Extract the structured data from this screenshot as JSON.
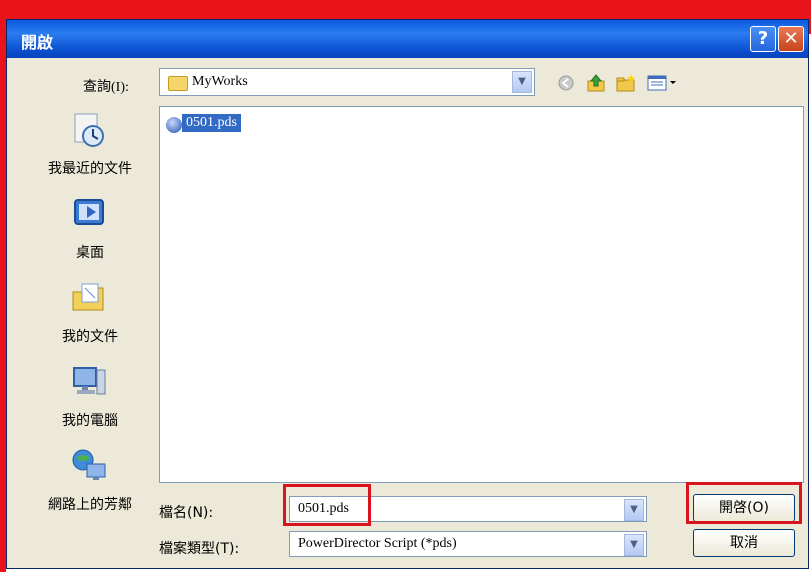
{
  "dialog": {
    "title": "開啟",
    "help_glyph": "?",
    "close_glyph": "✕"
  },
  "lookin": {
    "label": "查詢(I):",
    "value": "MyWorks"
  },
  "toolbar": {
    "icons": [
      "back-icon",
      "up-folder-icon",
      "new-folder-icon",
      "views-menu-icon"
    ]
  },
  "places": [
    {
      "label": "我最近的文件",
      "icon": "recent-documents-icon"
    },
    {
      "label": "桌面",
      "icon": "desktop-icon"
    },
    {
      "label": "我的文件",
      "icon": "my-documents-icon"
    },
    {
      "label": "我的電腦",
      "icon": "my-computer-icon"
    },
    {
      "label": "網路上的芳鄰",
      "icon": "network-places-icon"
    }
  ],
  "files": [
    {
      "name": "0501.pds",
      "selected": true
    }
  ],
  "filename": {
    "label": "檔名(N):",
    "value": "0501.pds"
  },
  "filetype": {
    "label": "檔案類型(T):",
    "value": "PowerDirector Script (*pds)"
  },
  "buttons": {
    "open": "開啓(O)",
    "cancel": "取消"
  },
  "colors": {
    "titlebar": "#0a4fd1",
    "dialog_bg": "#ece9d8",
    "selection": "#316ac5",
    "highlight_red": "#d8141e"
  }
}
